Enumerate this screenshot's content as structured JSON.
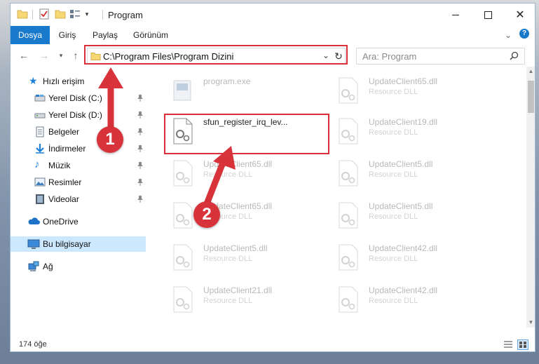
{
  "window": {
    "title": "Program"
  },
  "ribbon": {
    "tabs": [
      "Dosya",
      "Giriş",
      "Paylaş",
      "Görünüm"
    ]
  },
  "address": {
    "path": "C:\\Program Files\\Program Dizini"
  },
  "search": {
    "placeholder": "Ara: Program"
  },
  "sidebar": {
    "quick_access": "Hızlı erişim",
    "items": [
      {
        "label": "Yerel Disk (C:)",
        "icon": "drive-icon"
      },
      {
        "label": "Yerel Disk (D:)",
        "icon": "drive-icon"
      },
      {
        "label": "Belgeler",
        "icon": "documents-icon"
      },
      {
        "label": "İndirmeler",
        "icon": "downloads-icon"
      },
      {
        "label": "Müzik",
        "icon": "music-icon"
      },
      {
        "label": "Resimler",
        "icon": "pictures-icon"
      },
      {
        "label": "Videolar",
        "icon": "videos-icon"
      }
    ],
    "onedrive": "OneDrive",
    "this_pc": "Bu bilgisayar",
    "network": "Ağ"
  },
  "files": [
    {
      "name": "program.exe",
      "type": "",
      "faded": true
    },
    {
      "name": "UpdateClient65.dll",
      "type": "Resource DLL",
      "faded": true
    },
    {
      "name": "sfun_register_irq_lev...",
      "type": "",
      "faded": false
    },
    {
      "name": "UpdateClient19.dll",
      "type": "Resource DLL",
      "faded": true
    },
    {
      "name": "UpdateClient65.dll",
      "type": "Resource DLL",
      "faded": true
    },
    {
      "name": "UpdateClient5.dll",
      "type": "Resource DLL",
      "faded": true
    },
    {
      "name": "UpdateClient65.dll",
      "type": "Resource DLL",
      "faded": true
    },
    {
      "name": "UpdateClient5.dll",
      "type": "Resource DLL",
      "faded": true
    },
    {
      "name": "UpdateClient5.dll",
      "type": "Resource DLL",
      "faded": true
    },
    {
      "name": "UpdateClient42.dll",
      "type": "Resource DLL",
      "faded": true
    },
    {
      "name": "UpdateClient21.dll",
      "type": "Resource DLL",
      "faded": true
    },
    {
      "name": "UpdateClient42.dll",
      "type": "Resource DLL",
      "faded": true
    }
  ],
  "status": {
    "count": "174 öğe"
  },
  "annotations": {
    "badge1": "1",
    "badge2": "2",
    "color": "#d8323a"
  }
}
